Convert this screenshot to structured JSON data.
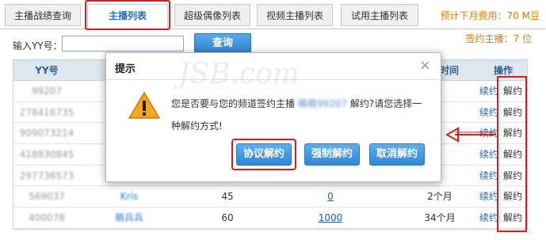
{
  "tabs": [
    {
      "label": "主播战绩查询"
    },
    {
      "label": "主播列表"
    },
    {
      "label": "超级偶像列表"
    },
    {
      "label": "视频主播列表"
    },
    {
      "label": "试用主播列表"
    }
  ],
  "fee_text": "预计下月费用：70 M豆",
  "signed_text": "签约主播：7 位",
  "search": {
    "label": "输入YY号：",
    "value": "",
    "button": "查询"
  },
  "table": {
    "headers": [
      "YY号",
      "",
      "",
      "",
      "签约时间",
      "操作"
    ],
    "rows": [
      {
        "yy": "99207",
        "nick": "",
        "c3": "",
        "link": "",
        "time": "",
        "renew": "续约",
        "cancel": "解约"
      },
      {
        "yy": "278416735",
        "nick": "",
        "c3": "",
        "link": "",
        "time": "",
        "renew": "续约",
        "cancel": "解约"
      },
      {
        "yy": "909073214",
        "nick": "",
        "c3": "",
        "link": "",
        "time": "",
        "renew": "续约",
        "cancel": "解约"
      },
      {
        "yy": "418830845",
        "nick": "",
        "c3": "",
        "link": "",
        "time": "",
        "renew": "续约",
        "cancel": "解约"
      },
      {
        "yy": "297736573",
        "nick": "",
        "c3": "",
        "link": "",
        "time": "",
        "renew": "续约",
        "cancel": "解约"
      },
      {
        "yy": "569037",
        "nick": "Kris",
        "c3": "45",
        "link": "0",
        "time": "2个月",
        "renew": "续约",
        "cancel": "解约"
      },
      {
        "yy": "400078",
        "nick": "萌兵兵",
        "c3": "60",
        "link": "1000",
        "time": "34个月",
        "renew": "续约",
        "cancel": "解约"
      }
    ]
  },
  "dialog": {
    "title": "提示",
    "close": "×",
    "msg_before": "您是否要与您的频道签约主播",
    "msg_name": "萌萌99207",
    "msg_after": "解约?请您选择一种解约方式!",
    "buttons": [
      "协议解约",
      "强制解约",
      "取消解约"
    ]
  },
  "watermark": "JSB.com",
  "colors": {
    "accent": "#2e82cf",
    "highlight": "#d81e1e",
    "fee": "#e07b00"
  }
}
